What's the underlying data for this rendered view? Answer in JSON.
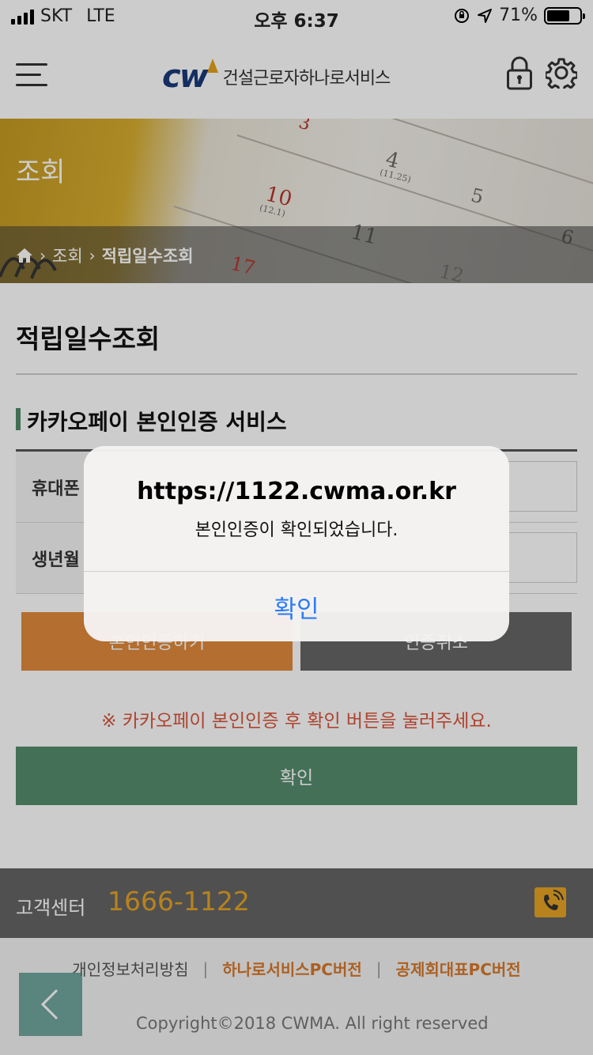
{
  "status_bar": {
    "carrier": "SKT",
    "network": "LTE",
    "time": "오후 6:37",
    "battery_percent": "71%",
    "battery_level": 0.71
  },
  "header": {
    "logo_mark": "cw",
    "logo_text": "건설근로자하나로서비스",
    "icons": [
      "menu-icon",
      "lock-icon",
      "gear-icon"
    ]
  },
  "banner": {
    "title": "조회",
    "breadcrumb": [
      "조회",
      "적립일수조회"
    ]
  },
  "main": {
    "page_title": "적립일수조회",
    "section_title": "카카오페이 본인인증 서비스",
    "form": {
      "rows": [
        {
          "label": "휴대폰"
        },
        {
          "label": "생년월"
        }
      ]
    },
    "request_button": "본인인증하기",
    "cancel_button": "인증취소",
    "notice": "※ 카카오페이 본인인증 후 확인 버튼을 눌러주세요.",
    "confirm_button": "확인"
  },
  "footer": {
    "cs_label": "고객센터",
    "cs_phone": "1666-1122",
    "links": [
      "개인정보처리방침",
      "하나로서비스PC버전",
      "공제회대표PC버전"
    ],
    "copyright": "Copyright©2018 CWMA. All right reserved"
  },
  "alert": {
    "title": "https://1122.cwma.or.kr",
    "message": "본인인증이 확인되었습니다.",
    "ok_button": "확인"
  },
  "colors": {
    "accent_green": "#558c6d",
    "accent_orange": "#e08a3c",
    "footer_gold": "#e7a325",
    "link_blue": "#2c7cf6",
    "notice_red": "#d9553c"
  }
}
